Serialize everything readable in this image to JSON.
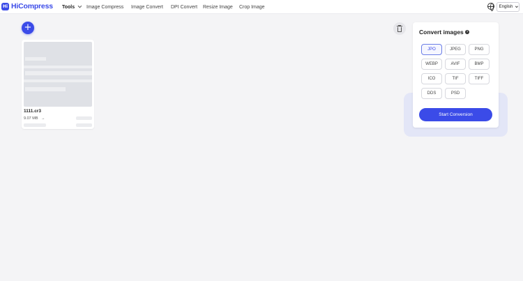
{
  "header": {
    "logo_badge": "Hi",
    "brand": "HiCompress",
    "nav": [
      {
        "label": "Tools"
      },
      {
        "label": "Image Compress"
      },
      {
        "label": "Image Convert"
      },
      {
        "label": "DPI Convert"
      },
      {
        "label": "Resize Image"
      },
      {
        "label": "Crop Image"
      }
    ],
    "language": "English",
    "icons": {
      "language": "globe-icon",
      "tools_menu": "chevron-down-icon"
    }
  },
  "toolbar": {
    "add_label": "+",
    "icons": {
      "add": "plus-icon",
      "delete": "trash-icon"
    }
  },
  "file": {
    "name": "1111.cr3",
    "size": "9.07 MB",
    "arrow": "→"
  },
  "convert": {
    "title": "Convert images",
    "help": "?",
    "formats": [
      "JPO",
      "JPEG",
      "PNG",
      "WEBP",
      "AVIF",
      "BMP",
      "ICO",
      "TIF",
      "TIFF",
      "DDS",
      "PSD"
    ],
    "selected": "JPO",
    "start_label": "Start Conversion"
  },
  "colors": {
    "accent": "#3b4be8",
    "background": "#f4f4f6"
  }
}
